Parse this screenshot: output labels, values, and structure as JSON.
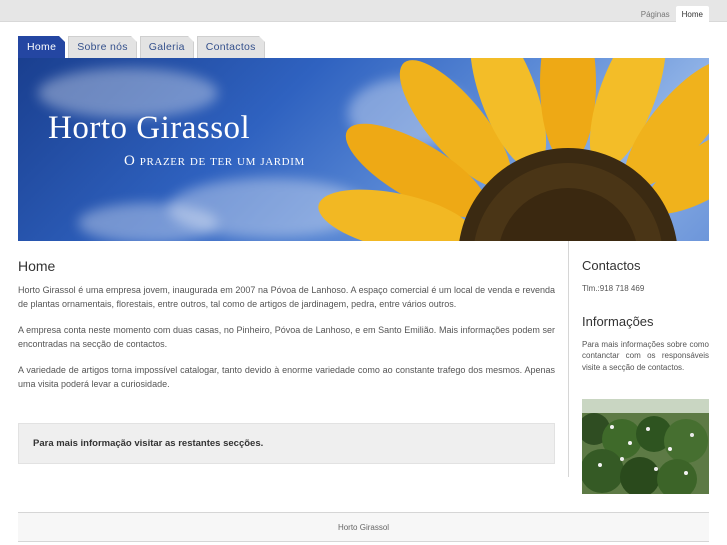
{
  "topbar": {
    "links": [
      {
        "label": "Páginas",
        "active": false
      },
      {
        "label": "Home",
        "active": true
      }
    ]
  },
  "nav": {
    "tabs": [
      {
        "label": "Home",
        "active": true
      },
      {
        "label": "Sobre nós",
        "active": false
      },
      {
        "label": "Galeria",
        "active": false
      },
      {
        "label": "Contactos",
        "active": false
      }
    ]
  },
  "banner": {
    "title": "Horto Girassol",
    "subtitle": "O prazer de ter um jardim"
  },
  "main": {
    "heading": "Home",
    "paragraphs": [
      "Horto Girassol é uma empresa jovem, inaugurada em 2007 na Póvoa de Lanhoso. A espaço comercial é um local de venda e revenda de plantas ornamentais, florestais, entre outros, tal como de artigos de jardinagem, pedra, entre vários outros.",
      "A empresa conta neste momento com duas casas, no Pinheiro, Póvoa de Lanhoso, e em Santo Emilião. Mais informações podem ser encontradas na secção de contactos.",
      "A variedade de artigos torna impossível catalogar, tanto devido à enorme variedade como ao constante trafego dos mesmos. Apenas uma visita poderá levar a curiosidade."
    ],
    "callout": "Para mais informação visitar as restantes secções."
  },
  "sidebar": {
    "contact_heading": "Contactos",
    "phone": "Tlm.:918 718 469",
    "info_heading": "Informações",
    "info_text": "Para mais informações sobre como contanctar com os responsáveis visite a secção de contactos."
  },
  "footer": {
    "text": "Horto Girassol"
  },
  "colors": {
    "accent": "#2446a2",
    "sky": "#2f62c0",
    "sunflower": "#f0b21c"
  }
}
